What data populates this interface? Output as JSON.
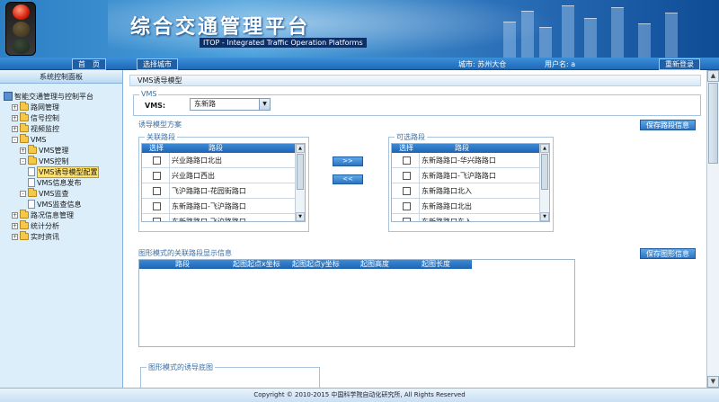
{
  "header": {
    "title": "综合交通管理平台",
    "subtitle": "ITOP - Integrated Traffic Operation Platforms"
  },
  "navbar": {
    "home_label": "首　页",
    "select_city_label": "选择城市",
    "city_text": "城市: 苏州大仓",
    "username_text": "用户名: a",
    "relogin_label": "重新登录"
  },
  "sidebar": {
    "title": "系统控制面板",
    "items": [
      {
        "label": "智能交通管理与控制平台",
        "level": 0,
        "icon": "root-icon"
      },
      {
        "label": "路网管理",
        "level": 1,
        "toggle": "+",
        "icon": "folder-icon"
      },
      {
        "label": "信号控制",
        "level": 1,
        "toggle": "+",
        "icon": "folder-icon"
      },
      {
        "label": "视频监控",
        "level": 1,
        "toggle": "+",
        "icon": "folder-icon"
      },
      {
        "label": "VMS",
        "level": 1,
        "toggle": "-",
        "icon": "folder-icon"
      },
      {
        "label": "VMS管理",
        "level": 2,
        "toggle": "+",
        "icon": "folder-icon"
      },
      {
        "label": "VMS控制",
        "level": 2,
        "toggle": "-",
        "icon": "folder-icon"
      },
      {
        "label": "VMS诱导模型配置",
        "level": 3,
        "icon": "page-icon",
        "selected": true
      },
      {
        "label": "VMS信息发布",
        "level": 3,
        "icon": "page-icon"
      },
      {
        "label": "VMS监查",
        "level": 2,
        "toggle": "-",
        "icon": "folder-icon"
      },
      {
        "label": "VMS监查信息",
        "level": 3,
        "icon": "page-icon"
      },
      {
        "label": "路况信息管理",
        "level": 1,
        "toggle": "+",
        "icon": "folder-icon"
      },
      {
        "label": "统计分析",
        "level": 1,
        "toggle": "+",
        "icon": "folder-icon"
      },
      {
        "label": "实时资讯",
        "level": 1,
        "toggle": "+",
        "icon": "folder-icon"
      }
    ]
  },
  "main": {
    "title": "VMS诱导模型",
    "vms_group_label": "VMS",
    "vms_field_label": "VMS:",
    "vms_selected": "东新路",
    "scheme_label": "诱导模型方案",
    "save_road_label": "保存路段信息",
    "linked_label": "关联路段",
    "available_label": "可选路段",
    "col_select": "选择",
    "col_road": "路段",
    "linked_rows": [
      "兴业路路口北出",
      "兴业路口西出",
      "飞沪路路口-花园街路口",
      "东新路路口-飞沪路路口",
      "东新路路口-飞沪路路口"
    ],
    "available_rows": [
      "东新路路口-华兴路路口",
      "东新路路口-飞沪路路口",
      "东新路路口北入",
      "东新路路口北出",
      "东新路路口东入"
    ],
    "move_right_label": ">>",
    "move_left_label": "<<",
    "graph_section_label": "图形模式的关联路段显示信息",
    "save_graph_label": "保存图形信息",
    "graph_columns": [
      "路段",
      "起图起点x坐标",
      "起图起点y坐标",
      "起图高度",
      "起图长度"
    ],
    "base_image_label": "图形模式的诱导底图"
  },
  "footer": {
    "copyright": "Copyright © 2010-2015 中国科学院自动化研究所, All Rights Reserved"
  }
}
